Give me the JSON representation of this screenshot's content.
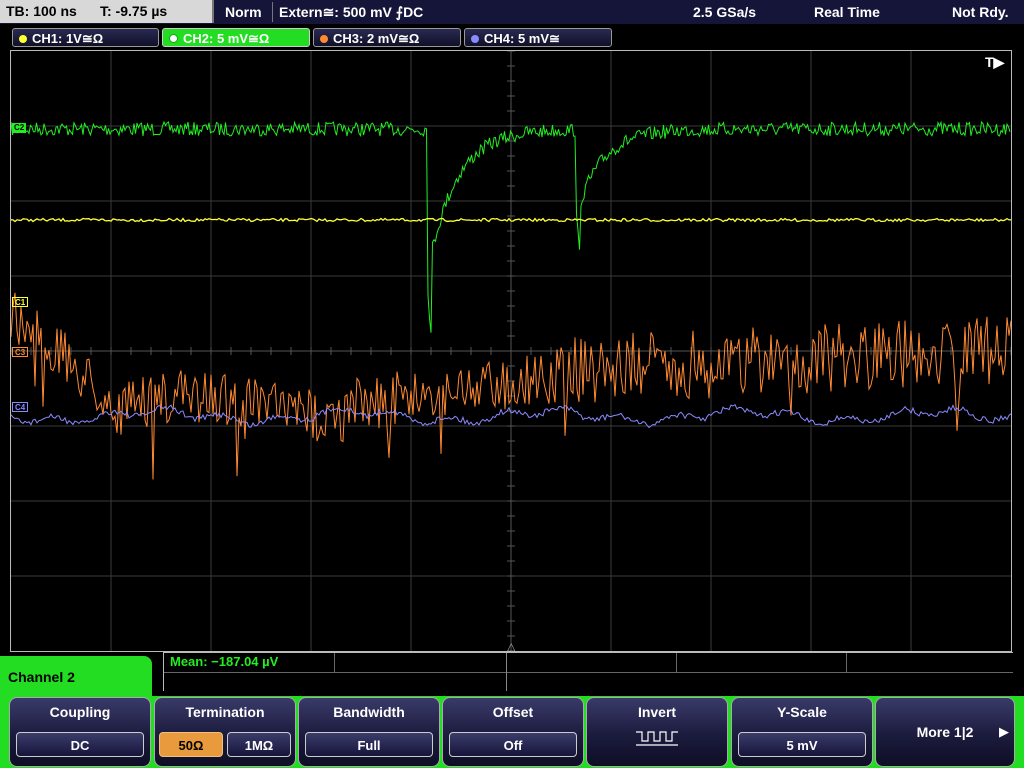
{
  "status_bar": {
    "timebase": "TB: 100 ns",
    "trigger_time": "T: -9.75 µs",
    "mode": "Norm",
    "trigger": "Extern≅: 500 mV ⨍DC",
    "sample_rate": "2.5 GSa/s",
    "acq_mode": "Real Time",
    "state": "Not Rdy."
  },
  "channels": [
    {
      "label": "CH1: 1V≅Ω",
      "color": "#ffff33"
    },
    {
      "label": "CH2: 5 mV≅Ω",
      "color": "#22ee22"
    },
    {
      "label": "CH3: 2 mV≅Ω",
      "color": "#ff8a33"
    },
    {
      "label": "CH4: 5 mV≅",
      "color": "#8a8aff"
    }
  ],
  "screen": {
    "trigger_marker": "T▶",
    "markers": {
      "c2": "C2",
      "c1": "C1",
      "c3": "C3",
      "c4": "C4"
    },
    "grid_color": "#3a3a3a"
  },
  "measurement": {
    "mean": "Mean: −187.04 µV"
  },
  "menu": {
    "title": "Channel 2",
    "softkeys": {
      "coupling": {
        "label": "Coupling",
        "value": "DC"
      },
      "termination": {
        "label": "Termination",
        "opt1": "50Ω",
        "opt2": "1MΩ"
      },
      "bandwidth": {
        "label": "Bandwidth",
        "value": "Full"
      },
      "offset": {
        "label": "Offset",
        "value": "Off"
      },
      "invert": {
        "label": "Invert"
      },
      "yscale": {
        "label": "Y-Scale",
        "value": "5 mV"
      },
      "more": {
        "label": "More 1|2"
      }
    }
  }
}
